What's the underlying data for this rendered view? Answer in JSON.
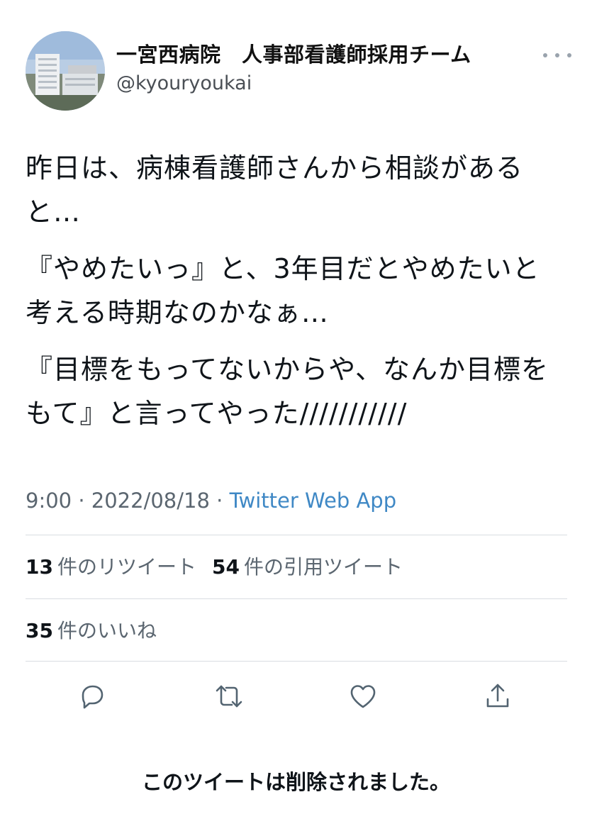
{
  "header": {
    "display_name": "一宮西病院　人事部看護師採用チーム",
    "handle": "@kyouryoukai"
  },
  "tweet": {
    "paragraphs": [
      "昨日は、病棟看護師さんから相談があると…",
      "『やめたいっ』と、3年目だとやめたいと考える時期なのかなぁ…",
      "『目標をもってないからや、なんか目標をもて』と言ってやった///////////"
    ]
  },
  "meta": {
    "time": "9:00",
    "date": "2022/08/18",
    "dot": "·",
    "source": "Twitter Web App"
  },
  "stats": {
    "retweets_count": "13",
    "retweets_label": "件のリツイート",
    "quotes_count": "54",
    "quotes_label": "件の引用ツイート",
    "likes_count": "35",
    "likes_label": "件のいいね"
  },
  "actions": {
    "icons": [
      "reply-icon",
      "retweet-icon",
      "like-icon",
      "share-icon"
    ],
    "icon_color": "#536471"
  },
  "notice": {
    "deleted": "このツイートは削除されました。"
  }
}
